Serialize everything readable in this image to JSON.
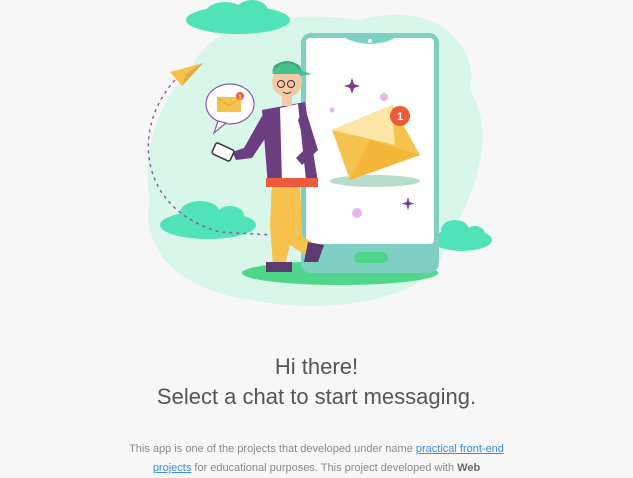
{
  "welcome": {
    "line1": "Hi there!",
    "line2": "Select a chat to start messaging."
  },
  "illustration": {
    "badge_count": "1",
    "bubble_badge": "1"
  },
  "description": {
    "before_link": "This app is one of the projects that developed under name ",
    "link_text": "practical front-end projects",
    "middle": " for educational purposes. This project developed with ",
    "bold_text": "Web"
  },
  "colors": {
    "background": "#f7f7f7",
    "mint": "#ccf4e4",
    "cloud": "#4fe3b7",
    "envelope": "#f6c24e",
    "badge": "#ee5a3c",
    "link": "#3b8ce0",
    "text": "#555555"
  },
  "icons": [
    "chat-bubble-icon",
    "envelope-icon",
    "notification-badge-icon",
    "sparkle-icon",
    "paper-plane-icon"
  ]
}
